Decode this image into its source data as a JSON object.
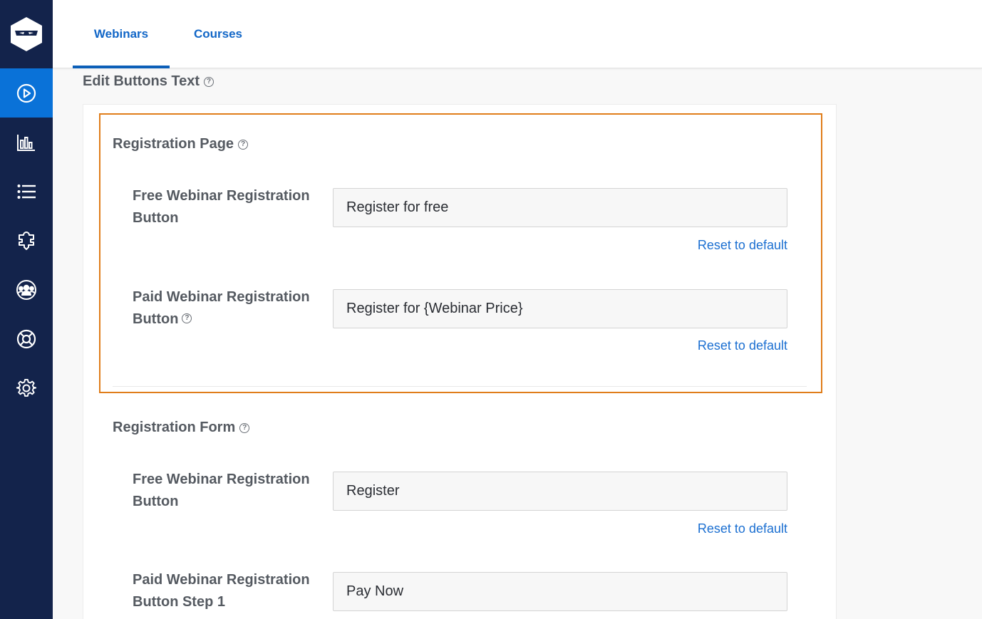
{
  "tabs": [
    {
      "label": "Webinars",
      "active": true
    },
    {
      "label": "Courses",
      "active": false
    }
  ],
  "sidebar": {
    "logo": "ninja-logo-icon",
    "items": [
      {
        "icon": "play-circle-icon",
        "active": true
      },
      {
        "icon": "bar-chart-icon",
        "active": false
      },
      {
        "icon": "list-icon",
        "active": false
      },
      {
        "icon": "puzzle-icon",
        "active": false
      },
      {
        "icon": "users-icon",
        "active": false
      },
      {
        "icon": "lifebuoy-icon",
        "active": false
      },
      {
        "icon": "gear-icon",
        "active": false
      }
    ]
  },
  "section_title": "Edit Buttons Text",
  "help_glyph": "?",
  "registration_page": {
    "title": "Registration Page",
    "fields": [
      {
        "label": "Free Webinar Registration Button",
        "value": "Register for free",
        "reset": "Reset to default"
      },
      {
        "label": "Paid Webinar Registration Button",
        "value": "Register for {Webinar Price}",
        "reset": "Reset to default"
      }
    ]
  },
  "registration_form": {
    "title": "Registration Form",
    "fields": [
      {
        "label": "Free Webinar Registration Button",
        "value": "Register",
        "reset": "Reset to default"
      },
      {
        "label": "Paid Webinar Registration Button Step 1",
        "value": "Pay Now"
      }
    ]
  },
  "colors": {
    "sidebar_bg": "#13234b",
    "sidebar_active": "#0a72d8",
    "accent": "#1166c7",
    "highlight_border": "#e07d1a"
  }
}
